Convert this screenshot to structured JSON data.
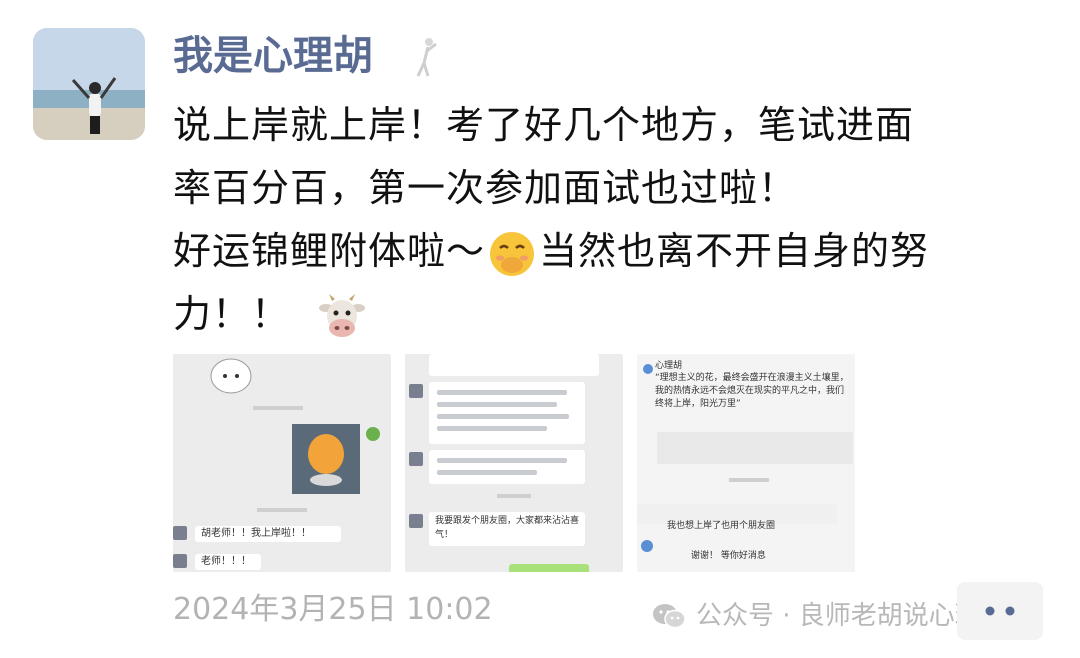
{
  "post": {
    "username": "我是心理胡",
    "text_lines": [
      "说上岸就上岸！考了好几个地方，笔试进面",
      "率百分百，第一次参加面试也过啦！",
      "好运锦鲤附体啦～",
      "当然也离不开自身的努",
      "力！！"
    ],
    "timestamp": "2024年3月25日 10:02"
  },
  "thumbnails": {
    "t1": {
      "caption_1": "胡老师！！我上岸啦！！",
      "caption_2": "老师！！！"
    },
    "t2": {
      "caption_1": "我要跟发个朋友圈，大家都来沾沾喜气！"
    },
    "t3": {
      "sender": "心理胡",
      "quote": "“理想主义的花，最终会盛开在浪漫主义土壤里，我的热情永远不会熄灭在现实的平凡之中，我们终将上岸，阳光万里”",
      "msg_1": "我也想上岸了也用个朋友圈",
      "msg_2": "谢谢！ 等你好消息"
    }
  },
  "watermark": {
    "text": "公众号 · 良师老胡说心理"
  },
  "icons": {
    "emoji_1": "hand-over-mouth-emoji-icon",
    "emoji_2": "cow-face-emoji-icon",
    "wm_icon": "wechat-icon"
  }
}
